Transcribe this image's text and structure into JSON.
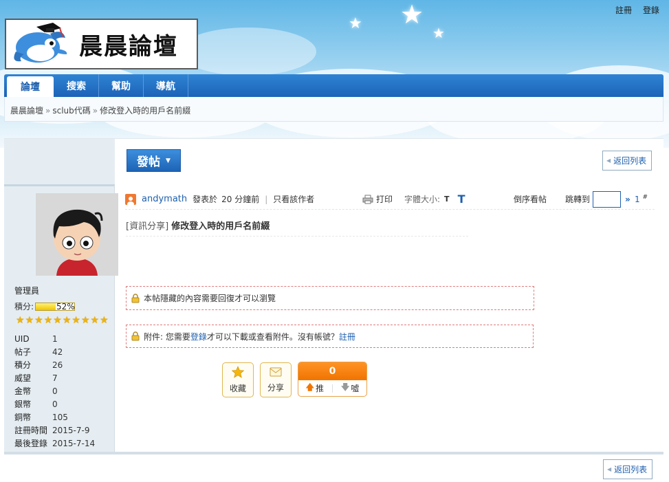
{
  "top_links": {
    "register": "註冊",
    "login": "登錄"
  },
  "logo": {
    "text": "晨晨論壇"
  },
  "nav": [
    {
      "label": "論壇",
      "active": true
    },
    {
      "label": "搜索",
      "active": false
    },
    {
      "label": "幫助",
      "active": false
    },
    {
      "label": "導航",
      "active": false
    }
  ],
  "breadcrumb": {
    "items": [
      "晨晨論壇",
      "sclub代碼",
      "修改登入時的用戶名前綴"
    ],
    "separator": "»"
  },
  "toolbar": {
    "post_label": "發帖",
    "back_label": "返回列表"
  },
  "author": {
    "role": "管理員",
    "score_label": "積分:",
    "score_pct_text": "52%",
    "score_fraction": 0.52,
    "star_count": 10,
    "stats": [
      {
        "k": "UID",
        "v": "1"
      },
      {
        "k": "帖子",
        "v": "42"
      },
      {
        "k": "積分",
        "v": "26"
      },
      {
        "k": "威望",
        "v": "7"
      },
      {
        "k": "金幣",
        "v": "0"
      },
      {
        "k": "銀幣",
        "v": "0"
      },
      {
        "k": "銅幣",
        "v": "105"
      },
      {
        "k": "註冊時間",
        "v": "2015-7-9"
      },
      {
        "k": "最後登錄",
        "v": "2015-7-14"
      }
    ]
  },
  "post": {
    "username": "andymath",
    "posted_prefix": "發表於",
    "posted_time": "20 分鐘前",
    "only_author": "只看該作者",
    "print_label": "打印",
    "font_size_label": "字體大小:",
    "font_small": "T",
    "font_large": "T",
    "reverse_label": "倒序看帖",
    "jump_label": "跳轉到",
    "jump_arrow": "»",
    "floor_number": "1",
    "floor_symbol": "#",
    "title_category": "[資訊分享]",
    "title_text": "修改登入時的用戶名前綴",
    "hidden_notice": "本帖隱藏的內容需要回復才可以瀏覽",
    "attach_prefix": "附件: 您需要",
    "attach_login": "登錄",
    "attach_middle": "才可以下載或查看附件。沒有帳號？",
    "attach_register": "註冊"
  },
  "actions": {
    "favorite": "收藏",
    "share": "分享",
    "vote_count": "0",
    "upvote": "推",
    "downvote": "噓"
  },
  "colors": {
    "nav_blue": "#1c63b8",
    "link_blue": "#1d5fae",
    "vote_orange": "#f07400",
    "star_gold": "#f0b400"
  }
}
